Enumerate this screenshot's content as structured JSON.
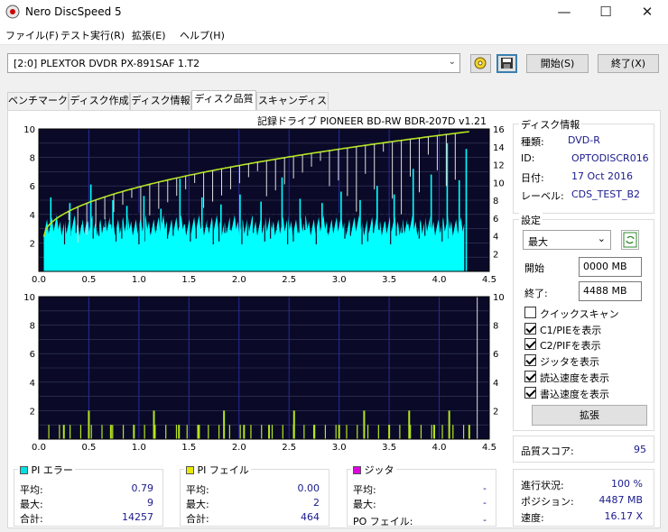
{
  "app": {
    "title": "Nero DiscSpeed 5"
  },
  "window_controls": {
    "minimize": "—",
    "maximize": "☐",
    "close": "✕"
  },
  "menu": [
    "ファイル(F)",
    "テスト実行(R)",
    "拡張(E)",
    "ヘルプ(H)"
  ],
  "toolbar": {
    "drive": "[2:0]   PLEXTOR DVDR   PX-891SAF 1.T2",
    "start_label": "開始(S)",
    "exit_label": "終了(X)"
  },
  "tabs": [
    {
      "label": "ベンチマーク",
      "active": false
    },
    {
      "label": "ディスク作成",
      "active": false
    },
    {
      "label": "ディスク情報",
      "active": false
    },
    {
      "label": "ディスク品質",
      "active": true
    },
    {
      "label": "スキャンディスク",
      "active": false
    }
  ],
  "drive_caption": "記録ドライブ PIONEER BD-RW   BDR-207D v1.21",
  "disc_info": {
    "title": "ディスク情報",
    "rows": [
      {
        "label": "種類:",
        "value": "DVD-R"
      },
      {
        "label": "ID:",
        "value": "OPTODISCR016"
      },
      {
        "label": "日付:",
        "value": "17 Oct 2016"
      },
      {
        "label": "レーベル:",
        "value": "CDS_TEST_B2"
      }
    ]
  },
  "settings": {
    "title": "設定",
    "speed": "最大",
    "start_label": "開始",
    "start_value": "0000 MB",
    "end_label": "終了:",
    "end_value": "4488 MB",
    "checks": [
      {
        "label": "クイックスキャン",
        "checked": false
      },
      {
        "label": "C1/PIEを表示",
        "checked": true
      },
      {
        "label": "C2/PIFを表示",
        "checked": true
      },
      {
        "label": "ジッタを表示",
        "checked": true
      },
      {
        "label": "読込速度を表示",
        "checked": true
      },
      {
        "label": "書込速度を表示",
        "checked": true
      }
    ],
    "advanced_label": "拡張"
  },
  "quality": {
    "label": "品質スコア:",
    "value": "95"
  },
  "progress": {
    "rows": [
      {
        "label": "進行状況:",
        "value": "100 %"
      },
      {
        "label": "ポジション:",
        "value": "4487 MB"
      },
      {
        "label": "速度:",
        "value": "16.17 X"
      }
    ]
  },
  "pi_error": {
    "title": "PI エラー",
    "color": "#00e0e0",
    "rows": [
      {
        "label": "平均:",
        "value": "0.79"
      },
      {
        "label": "最大:",
        "value": "9"
      },
      {
        "label": "合計:",
        "value": "14257"
      }
    ]
  },
  "pi_fail": {
    "title": "PI フェイル",
    "color": "#e8e800",
    "rows": [
      {
        "label": "平均:",
        "value": "0.00"
      },
      {
        "label": "最大:",
        "value": "2"
      },
      {
        "label": "合計:",
        "value": "464"
      }
    ]
  },
  "jitter": {
    "title": "ジッタ",
    "color": "#e000e0",
    "rows": [
      {
        "label": "平均:",
        "value": "-"
      },
      {
        "label": "最大:",
        "value": "-"
      }
    ],
    "po_label": "PO フェイル:",
    "po_value": "-"
  },
  "chart_data": [
    {
      "type": "bar",
      "x_ticks": [
        "0.0",
        "0.5",
        "1.0",
        "1.5",
        "2.0",
        "2.5",
        "3.0",
        "3.5",
        "4.0",
        "4.5"
      ],
      "y_left_ticks": [
        "2",
        "4",
        "6",
        "8",
        "10"
      ],
      "y_right_ticks": [
        "2",
        "4",
        "6",
        "8",
        "10",
        "12",
        "14",
        "16"
      ],
      "xlim": [
        0,
        4.5
      ],
      "ylim_left": [
        0,
        10
      ],
      "ylim_right": [
        0,
        16
      ],
      "series": [
        {
          "color": "#00ffff",
          "base_level": 3.3,
          "spikes": [
            [
              0.12,
              5.2
            ],
            [
              0.31,
              4.8
            ],
            [
              0.52,
              6.1
            ],
            [
              0.74,
              5.0
            ],
            [
              0.88,
              4.6
            ],
            [
              1.05,
              5.3
            ],
            [
              1.22,
              4.4
            ],
            [
              1.41,
              6.5
            ],
            [
              1.63,
              5.2
            ],
            [
              1.82,
              4.7
            ],
            [
              2.01,
              5.4
            ],
            [
              2.22,
              4.9
            ],
            [
              2.43,
              6.6
            ],
            [
              2.61,
              5.1
            ],
            [
              2.83,
              4.8
            ],
            [
              3.02,
              5.6
            ],
            [
              3.21,
              5.0
            ],
            [
              3.38,
              6.0
            ],
            [
              3.55,
              5.4
            ],
            [
              3.74,
              7.2
            ],
            [
              3.92,
              6.8
            ],
            [
              4.08,
              9.0
            ],
            [
              4.2,
              6.4
            ],
            [
              4.27,
              8.6
            ]
          ]
        },
        {
          "color": "#b5e61d",
          "start": [
            0.05,
            3.9
          ],
          "end": [
            4.3,
            15.7
          ]
        }
      ]
    },
    {
      "type": "bar",
      "x_ticks": [
        "0.0",
        "0.5",
        "1.0",
        "1.5",
        "2.0",
        "2.5",
        "3.0",
        "3.5",
        "4.0",
        "4.5"
      ],
      "y_left_ticks": [
        "2",
        "4",
        "6",
        "8",
        "10"
      ],
      "y_right_ticks": [
        "2",
        "4",
        "6",
        "8",
        "10"
      ],
      "xlim": [
        0,
        4.5
      ],
      "ylim": [
        0,
        10
      ],
      "series": [
        {
          "color": "#b5e61d",
          "values": [
            [
              0.25,
              1
            ],
            [
              0.5,
              2
            ],
            [
              0.72,
              1
            ],
            [
              0.95,
              1
            ],
            [
              1.15,
              2
            ],
            [
              1.4,
              1
            ],
            [
              1.6,
              1
            ],
            [
              1.85,
              2
            ],
            [
              2.05,
              1
            ],
            [
              2.3,
              1
            ],
            [
              2.55,
              2
            ],
            [
              2.75,
              1
            ],
            [
              3.0,
              1
            ],
            [
              3.25,
              2
            ],
            [
              3.5,
              1
            ],
            [
              3.7,
              2
            ],
            [
              3.95,
              1
            ],
            [
              4.1,
              2
            ],
            [
              4.3,
              1
            ]
          ]
        }
      ]
    }
  ]
}
